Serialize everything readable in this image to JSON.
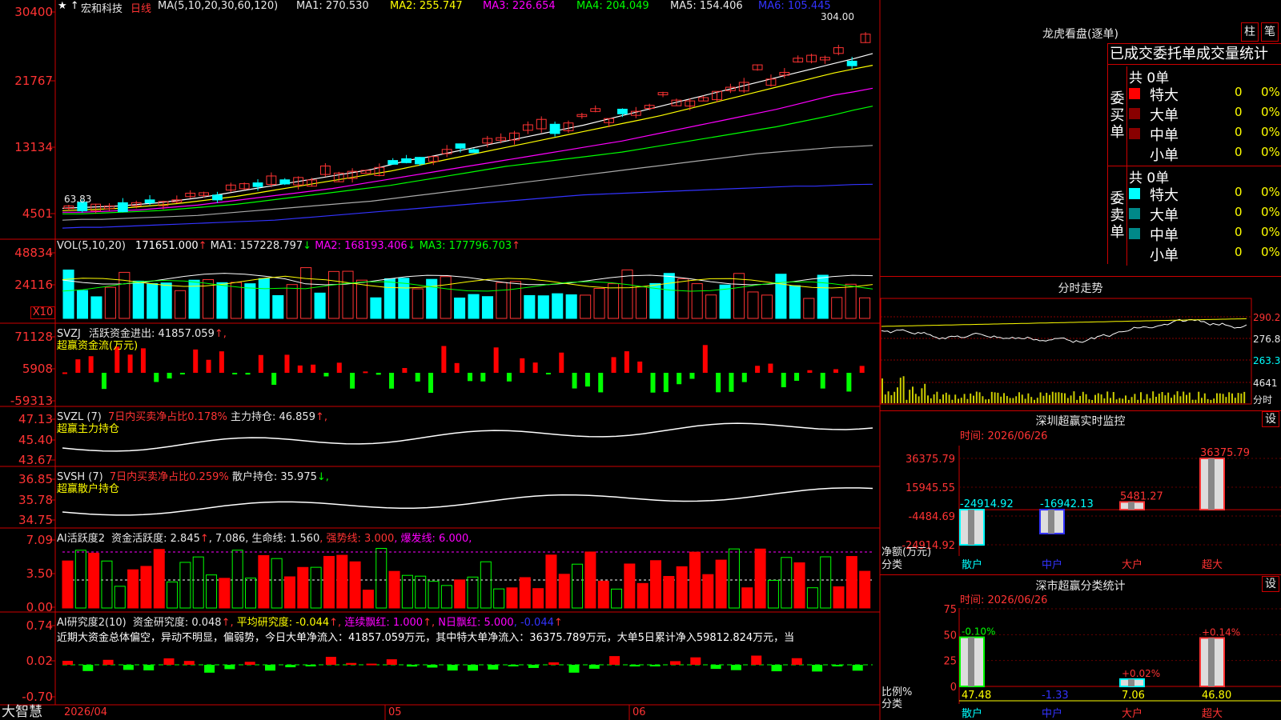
{
  "colors": {
    "up": "#ff3333",
    "down": "#00ffff",
    "ma1": "#ffffff",
    "ma2": "#ffff00",
    "ma3": "#ff00ff",
    "ma4": "#00ff00",
    "ma5": "#aaaaaa",
    "ma6": "#3333ff",
    "grid": "#aa0000",
    "gain": "#ff0000",
    "loss": "#00ff00",
    "label": "#ff3333"
  },
  "main": {
    "stock_name": "宏和科技",
    "period": "日线",
    "ma_header": "MA(5,10,20,30,60,120)",
    "ma1": "MA1: 270.530",
    "ma2": "MA2: 255.747",
    "ma3": "MA3: 226.654",
    "ma4": "MA4: 204.049",
    "ma5": "MA5: 154.406",
    "ma6": "MA6: 105.445",
    "y_labels": [
      "30400",
      "21767",
      "13134",
      "4501"
    ],
    "high_label": "304.00",
    "low_label": "63.83"
  },
  "vol": {
    "header": "VOL(5,10,20)",
    "val": "171651.000",
    "ma1": "MA1: 157228.797",
    "ma2": "MA2: 168193.406",
    "ma3": "MA3: 177796.703",
    "y_labels": [
      "48834",
      "24116"
    ],
    "unit": "X10"
  },
  "svzj": {
    "header": "SVZJ",
    "label": "活跃资金进出: 41857.059",
    "sub": "超赢资金流(万元)",
    "y_labels": [
      "71128",
      "5908",
      "-59313"
    ]
  },
  "svzl": {
    "header": "SVZL (7)",
    "ratio": "7日内买卖净占比0.178%",
    "hold": "主力持仓: 46.859",
    "sub": "超赢主力持仓",
    "y_labels": [
      "47.13",
      "45.40",
      "43.67"
    ]
  },
  "svsh": {
    "header": "SVSH (7)",
    "ratio": "7日内买卖净占比0.259%",
    "hold": "散户持仓: 35.975",
    "sub": "超赢散户持仓",
    "y_labels": [
      "36.85",
      "35.78",
      "34.75"
    ]
  },
  "ai1": {
    "header": "AI活跃度2",
    "act": "资金活跃度: 2.845",
    "v2": ", 7.086",
    "life": ", 生命线: 1.560",
    "strong": ", 强势线: 3.000",
    "burst": ", 爆发线: 6.000,",
    "y_labels": [
      "7.09",
      "3.50",
      "0.00"
    ]
  },
  "ai2": {
    "header": "AI研究度2(10)",
    "study": "资金研究度: 0.048",
    "avg": "平均研究度: -0.044",
    "red": "连续飘红: 1.000",
    "nred": "N日飘红: 5.000",
    "neg": ", -0.044",
    "note": "近期大资金总体偏空，异动不明显，偏弱势，今日大单净流入：41857.059万元，其中特大单净流入：36375.789万元，大单5日累计净入59812.824万元，当",
    "y_labels": [
      "0.74",
      "0.02",
      "-0.70"
    ]
  },
  "xaxis": {
    "brand": "大智慧",
    "d1": "2026/04",
    "d2": "05",
    "d3": "06"
  },
  "lhk": {
    "title": "龙虎看盘(逐单)",
    "btn1": "柱",
    "btn2": "笔",
    "head": "已成交委托单成交量统计",
    "buy": {
      "side": "委买单",
      "total": "共 0单",
      "rows": [
        {
          "name": "特大",
          "count": "0",
          "pct": "0%"
        },
        {
          "name": "大单",
          "count": "0",
          "pct": "0%"
        },
        {
          "name": "中单",
          "count": "0",
          "pct": "0%"
        },
        {
          "name": "小单",
          "count": "0",
          "pct": "0%"
        }
      ]
    },
    "sell": {
      "side": "委卖单",
      "total": "共 0单",
      "rows": [
        {
          "name": "特大",
          "count": "0",
          "pct": "0%"
        },
        {
          "name": "大单",
          "count": "0",
          "pct": "0%"
        },
        {
          "name": "中单",
          "count": "0",
          "pct": "0%"
        },
        {
          "name": "小单",
          "count": "0",
          "pct": "0%"
        }
      ]
    }
  },
  "intraday": {
    "title": "分时走势",
    "y_labels": [
      "290.2",
      "276.8",
      "263.3",
      "4641"
    ],
    "vol_label": "分时"
  },
  "monitor": {
    "title": "深圳超赢实时监控",
    "btn": "设",
    "time": "时间: 2026/06/26",
    "y_labels": [
      "36375.79",
      "15945.55",
      "-4484.69",
      "-24914.92"
    ],
    "ylabel": "净额(万元)",
    "xlabel": "分类"
  },
  "classify": {
    "title": "深市超赢分类统计",
    "btn": "设",
    "time": "时间: 2026/06/26",
    "y_labels": [
      "75",
      "50",
      "25",
      "0"
    ],
    "ylabel": "比例%",
    "xlabel": "分类"
  },
  "chart_data": [
    {
      "type": "bar",
      "title": "深圳超赢实时监控",
      "categories": [
        "散户",
        "中户",
        "大户",
        "超大"
      ],
      "values": [
        -24914.92,
        -16942.13,
        5481.27,
        36375.79
      ],
      "ylim": [
        -24914.92,
        36375.79
      ],
      "ylabel": "净额(万元)",
      "xlabel": "分类"
    },
    {
      "type": "bar",
      "title": "深市超赢分类统计",
      "categories": [
        "散户",
        "中户",
        "大户",
        "超大"
      ],
      "values": [
        47.48,
        -1.33,
        7.06,
        46.8
      ],
      "changes": [
        "-0.10%",
        "",
        "+0.02%",
        "+0.14%"
      ],
      "ylim": [
        0,
        75
      ],
      "ylabel": "比例%",
      "xlabel": "分类"
    },
    {
      "type": "line",
      "title": "日线",
      "series": [
        {
          "name": "MA1",
          "values": [
            75,
            76,
            77,
            78,
            80,
            82,
            85,
            88,
            92,
            96,
            100,
            104,
            108,
            112,
            116,
            120,
            124,
            130,
            136,
            140,
            145,
            150,
            155,
            160,
            165,
            170,
            175,
            180,
            186,
            192,
            198,
            204,
            210,
            216,
            222,
            228,
            234,
            240,
            246,
            252,
            258,
            264,
            270.53
          ]
        },
        {
          "name": "MA2",
          "values": [
            72,
            73,
            74,
            75,
            77,
            79,
            81,
            84,
            87,
            90,
            94,
            98,
            102,
            106,
            110,
            114,
            118,
            122,
            127,
            132,
            137,
            142,
            147,
            152,
            157,
            162,
            167,
            172,
            177,
            182,
            187,
            192,
            198,
            204,
            210,
            216,
            222,
            228,
            234,
            240,
            246,
            251,
            255.747
          ]
        },
        {
          "name": "MA3",
          "values": [
            70,
            70,
            71,
            72,
            73,
            75,
            77,
            79,
            82,
            85,
            88,
            91,
            94,
            97,
            100,
            104,
            108,
            112,
            116,
            120,
            124,
            128,
            132,
            136,
            140,
            144,
            148,
            152,
            156,
            160,
            165,
            170,
            175,
            180,
            185,
            190,
            195,
            200,
            206,
            212,
            218,
            222,
            226.654
          ]
        },
        {
          "name": "MA4",
          "values": [
            68,
            68,
            69,
            70,
            71,
            72,
            74,
            76,
            78,
            80,
            83,
            86,
            89,
            92,
            95,
            98,
            101,
            104,
            108,
            112,
            116,
            120,
            124,
            128,
            131,
            134,
            137,
            140,
            143,
            146,
            150,
            154,
            158,
            162,
            166,
            170,
            174,
            178,
            183,
            188,
            193,
            199,
            204.049
          ]
        },
        {
          "name": "MA5",
          "values": [
            60,
            61,
            61,
            62,
            63,
            64,
            65,
            66,
            68,
            70,
            72,
            74,
            76,
            78,
            80,
            82,
            84,
            87,
            90,
            93,
            96,
            99,
            102,
            105,
            108,
            111,
            114,
            117,
            120,
            123,
            126,
            129,
            132,
            135,
            138,
            141,
            144,
            146,
            148,
            150,
            152,
            153,
            154.406
          ]
        },
        {
          "name": "MA6",
          "values": [
            50,
            51,
            51,
            52,
            53,
            54,
            55,
            56,
            57,
            58,
            59,
            60,
            62,
            64,
            66,
            68,
            70,
            72,
            74,
            76,
            78,
            80,
            82,
            84,
            86,
            88,
            90,
            92,
            93,
            94,
            95,
            96,
            97,
            98,
            99,
            100,
            101,
            102,
            103,
            103,
            104,
            105,
            105.445
          ]
        }
      ]
    }
  ]
}
